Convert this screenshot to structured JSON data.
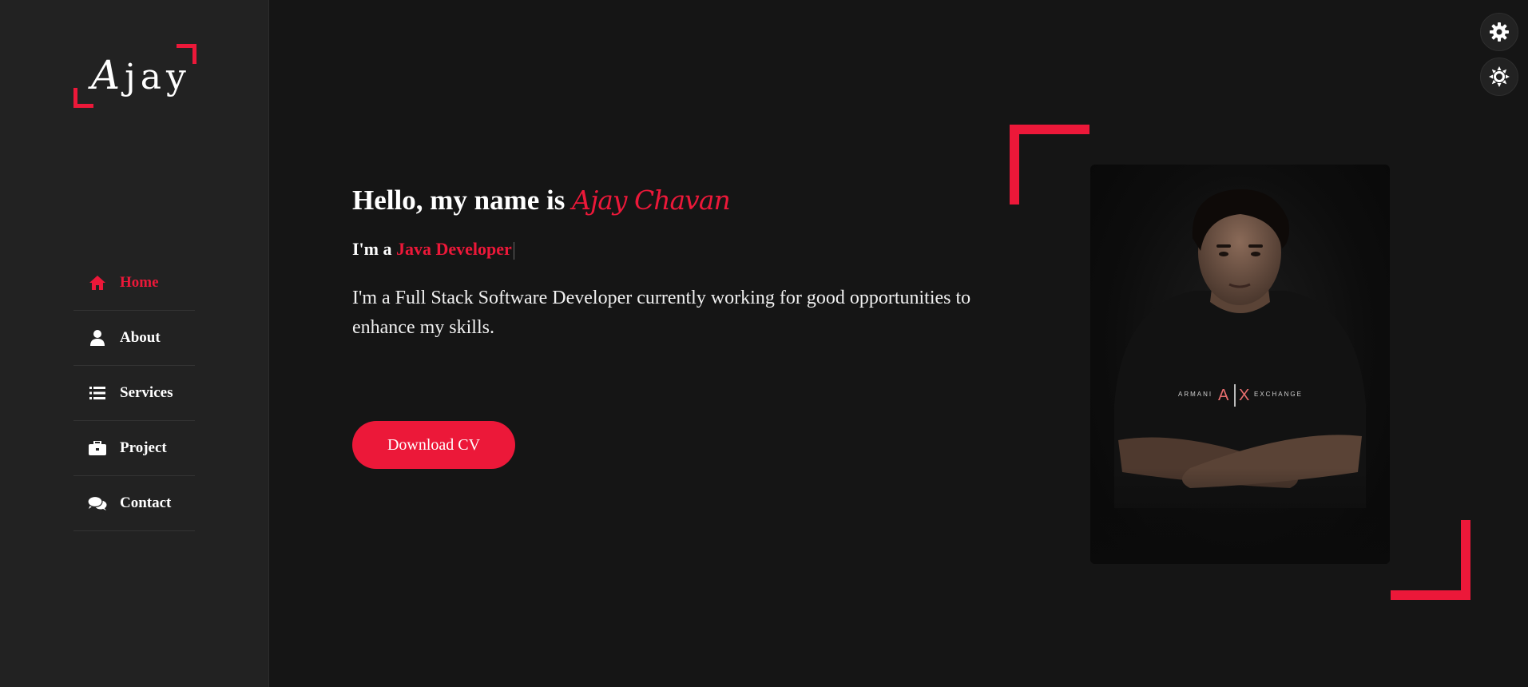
{
  "logo": {
    "first_letter": "A",
    "rest": "jay"
  },
  "nav": {
    "items": [
      {
        "label": "Home",
        "icon": "home-icon",
        "active": true
      },
      {
        "label": "About",
        "icon": "user-icon",
        "active": false
      },
      {
        "label": "Services",
        "icon": "list-icon",
        "active": false
      },
      {
        "label": "Project",
        "icon": "briefcase-icon",
        "active": false
      },
      {
        "label": "Contact",
        "icon": "comments-icon",
        "active": false
      }
    ]
  },
  "controls": {
    "settings_icon": "gear-icon",
    "theme_icon": "sun-icon"
  },
  "hero": {
    "greeting": "Hello, my name is ",
    "name": "Ajay Chavan",
    "role_prefix": "I'm a ",
    "role": "Java Developer",
    "description": "I'm a Full Stack Software Developer currently working for good opportunities to enhance my skills.",
    "button_label": "Download CV"
  },
  "photo": {
    "shirt_text": "ARMANI A|X EXCHANGE"
  },
  "colors": {
    "accent": "#ec1839",
    "background": "#151515",
    "sidebar": "#222222",
    "text": "#ffffff"
  }
}
